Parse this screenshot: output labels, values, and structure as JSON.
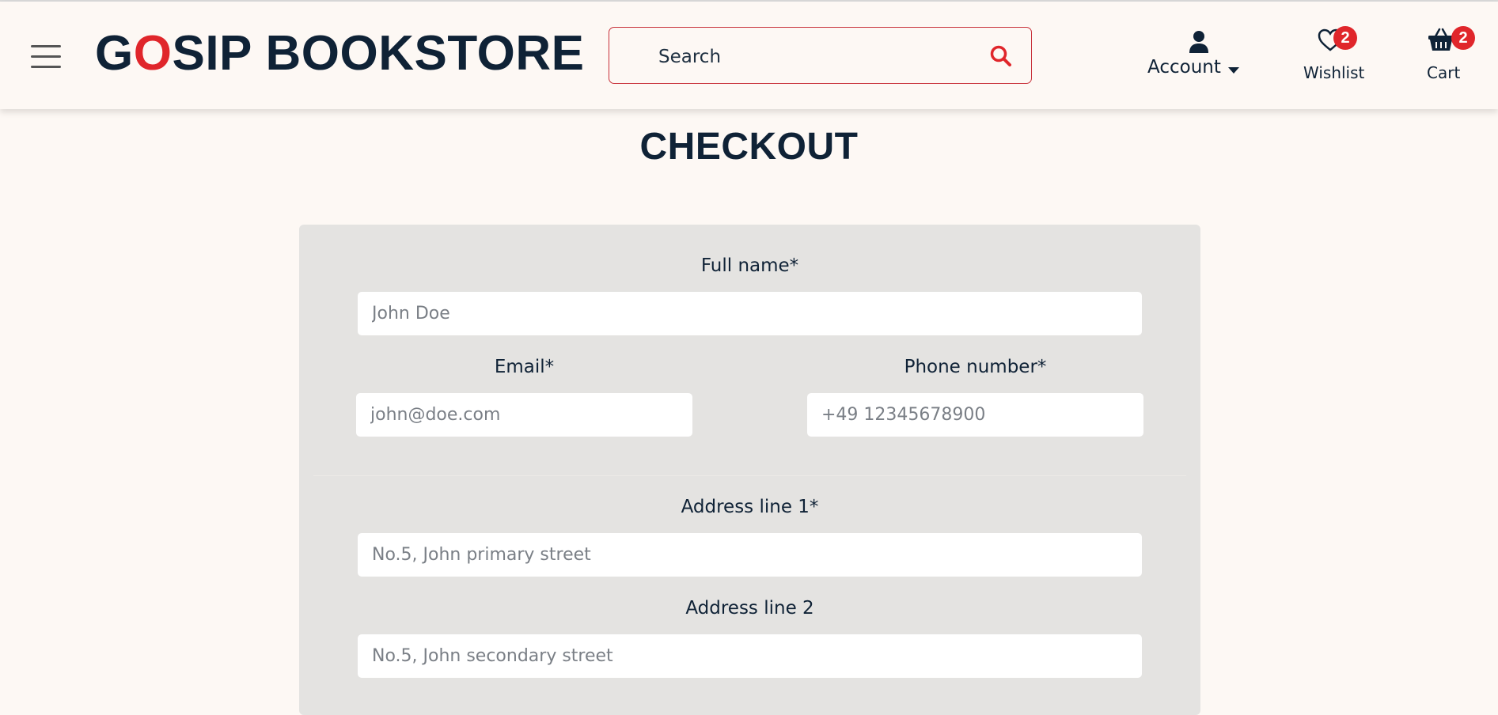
{
  "header": {
    "logo": {
      "prefix": "G",
      "highlight": "O",
      "suffix": "SIP BOOKSTORE"
    },
    "search": {
      "placeholder": "Search",
      "value": ""
    },
    "account": {
      "label": "Account"
    },
    "wishlist": {
      "label": "Wishlist",
      "count": "2"
    },
    "cart": {
      "label": "Cart",
      "count": "2"
    }
  },
  "page": {
    "title": "CHECKOUT"
  },
  "form": {
    "full_name": {
      "label": "Full name*",
      "placeholder": "John Doe"
    },
    "email": {
      "label": "Email*",
      "placeholder": "john@doe.com"
    },
    "phone": {
      "label": "Phone number*",
      "placeholder": "+49 12345678900"
    },
    "address1": {
      "label": "Address line 1*",
      "placeholder": "No.5, John primary street"
    },
    "address2": {
      "label": "Address line 2",
      "placeholder": "No.5, John secondary street"
    }
  },
  "colors": {
    "accent": "#e0262b",
    "text": "#0f2236",
    "background": "#fdf8f4",
    "card": "#e4e3e1"
  },
  "icons": [
    "menu-icon",
    "search-icon",
    "user-icon",
    "caret-down-icon",
    "heart-icon",
    "basket-icon"
  ]
}
